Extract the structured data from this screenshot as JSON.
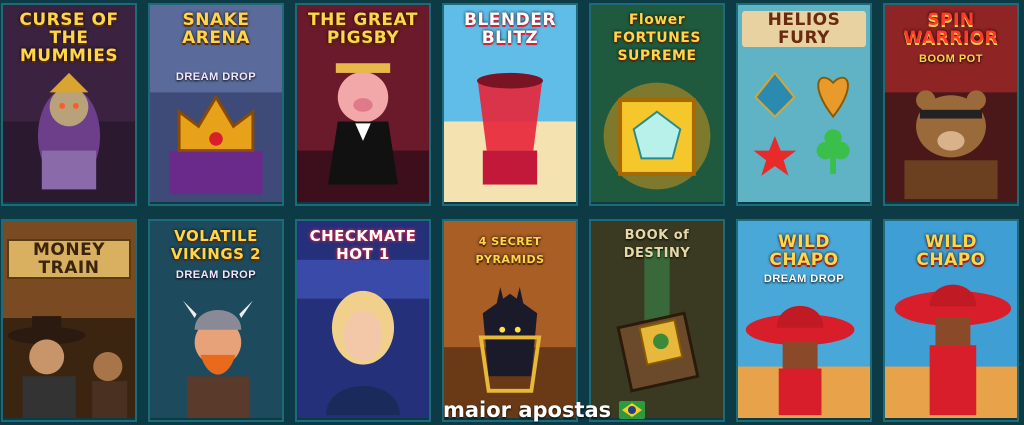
{
  "games": [
    {
      "title": "CURSE OF THE MUMMIES",
      "subtitle": "",
      "icon": "mummy-icon",
      "colors": [
        "#4a2a55",
        "#2b1a2f"
      ]
    },
    {
      "title": "SNAKE ARENA",
      "subtitle": "DREAM DROP",
      "icon": "crown-icon",
      "colors": [
        "#4e5b8c",
        "#2d3a66"
      ]
    },
    {
      "title": "THE GREAT PIGSBY",
      "subtitle": "",
      "icon": "pig-icon",
      "colors": [
        "#8c2a3a",
        "#3d0f1d"
      ]
    },
    {
      "title": "BLENDER BLITZ",
      "subtitle": "",
      "icon": "blender-icon",
      "colors": [
        "#5fbde8",
        "#1d6fa8"
      ]
    },
    {
      "title": "Flower FORTUNES SUPREME",
      "subtitle": "",
      "icon": "gem-icon",
      "colors": [
        "#2a6a4a",
        "#0f2f22"
      ]
    },
    {
      "title": "HELIOS FURY",
      "subtitle": "",
      "icon": "card-suits-icon",
      "colors": [
        "#63b9c9",
        "#2a8293"
      ]
    },
    {
      "title": "SPIN WARRIOR",
      "subtitle": "BOOM POT",
      "icon": "bear-icon",
      "colors": [
        "#a02c2c",
        "#4a1010"
      ]
    },
    {
      "title": "MONEY TRAIN",
      "subtitle": "",
      "icon": "cowboy-icon",
      "colors": [
        "#8c5a2a",
        "#3b2410"
      ]
    },
    {
      "title": "VOLATILE VIKINGS 2",
      "subtitle": "DREAM DROP",
      "icon": "viking-icon",
      "colors": [
        "#2a5c73",
        "#122d3a"
      ]
    },
    {
      "title": "CHECKMATE HOT 1",
      "subtitle": "",
      "icon": "woman-icon",
      "colors": [
        "#2a3c9a",
        "#101a4a"
      ]
    },
    {
      "title": "4 SECRET PYRAMIDS",
      "subtitle": "",
      "icon": "anubis-icon",
      "colors": [
        "#a8632a",
        "#4a2810"
      ]
    },
    {
      "title": "BOOK of DESTINY",
      "subtitle": "",
      "icon": "book-icon",
      "colors": [
        "#4a4a2a",
        "#1f1f12"
      ]
    },
    {
      "title": "WILD CHAPO",
      "subtitle": "DREAM DROP",
      "icon": "sombrero-icon",
      "colors": [
        "#4aa8d8",
        "#1e6a9a"
      ]
    },
    {
      "title": "WILD CHAPO",
      "subtitle": "",
      "icon": "sombrero-icon",
      "colors": [
        "#3f9fd4",
        "#1a5f8f"
      ]
    }
  ],
  "watermark": {
    "text": "maior apostas",
    "flag_icon": "brazil-flag-icon"
  }
}
